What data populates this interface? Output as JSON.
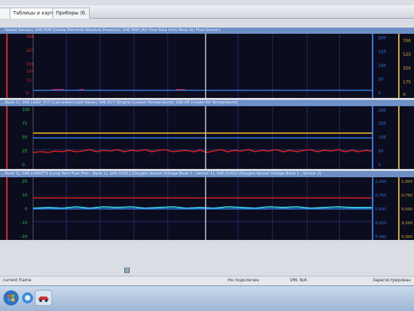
{
  "tabs": [
    "Таблицы и карты",
    "Приборы (б."
  ],
  "charts": [
    {
      "header": "...Speed Sensor], SAE.MAP [Intake Manifold Absolute Pressure], SAE.MAF [Air Flow Rate from Mass Air Flow Sensor]",
      "left_ticks": [
        "300",
        "225",
        "150",
        "100",
        "75",
        "0"
      ],
      "right_blue_ticks": [
        "200",
        "150",
        "100",
        "50",
        "0"
      ],
      "right_yellow_ticks": [
        "700",
        "525",
        "350",
        "175",
        "0"
      ]
    },
    {
      "header": "...Bank 1], SAE.LOAD_PCT [Calculated Load Value], SAE.ECT [Engine Coolant Temperature], SAE.IAT [Intake Air Temperature]",
      "left_ticks": [
        "100",
        "75",
        "50",
        "25",
        "0"
      ],
      "right_blue_ticks": [
        "200",
        "150",
        "100",
        "50",
        "0"
      ],
      "right_yellow_ticks": []
    },
    {
      "header": "...Bank 1], SAE.LONGFT1 [Long Term Fuel Trim - Bank 1], SAE.O2S11 [Oxygen Sensor Voltage Bank 1 - Sensor 1], SAE.O2S12 [Oxygen Sensor Voltage Bank 1 - Sensor 2]",
      "left_ticks": [
        "20",
        "10",
        "0",
        "-10",
        "-20"
      ],
      "right_blue_ticks": [
        "1,000",
        "0,750",
        "0,500",
        "0,250",
        "0,000"
      ],
      "right_yellow_ticks": [
        "1,000",
        "0,750",
        "0,500",
        "0,250",
        "0,000"
      ]
    }
  ],
  "status": {
    "left": "current frame",
    "connection": "Не подключен",
    "vin": "VIN: N/A",
    "right": "Зарегистрирован"
  },
  "colors": {
    "plot_bg": "#0b0d1f",
    "grid": "#2a3a8a",
    "red_series": "#e02424",
    "blue_series": "#2f7fe8",
    "yellow_series": "#e0b22a",
    "cursor": "#cfcfcf"
  }
}
